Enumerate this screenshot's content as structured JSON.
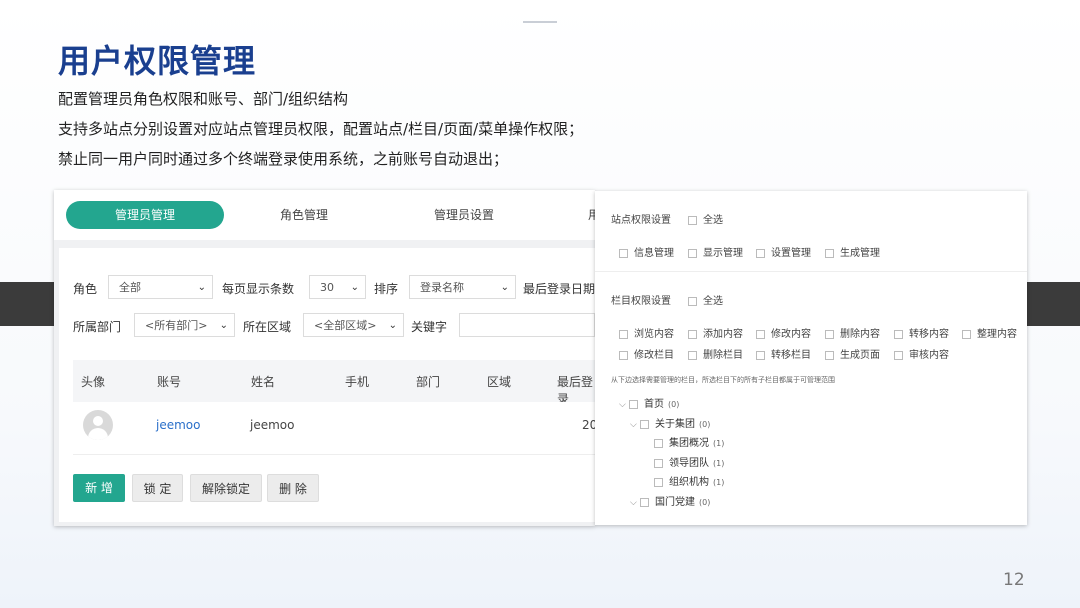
{
  "slide": {
    "title": "用户权限管理",
    "lines": [
      "配置管理员角色权限和账号、部门/组织结构",
      "支持多站点分别设置对应站点管理员权限，配置站点/栏目/页面/菜单操作权限；",
      "禁止同一用户同时通过多个终端登录使用系统，之前账号自动退出；"
    ],
    "page_number": "12",
    "accent_color": "#1a3f8f"
  },
  "admin_panel": {
    "tabs": [
      "管理员管理",
      "角色管理",
      "管理员设置",
      "用"
    ],
    "active_tab": "管理员管理",
    "accent_color": "#23a68f",
    "filters": {
      "role_label": "角色",
      "role_value": "全部",
      "pagesize_label": "每页显示条数",
      "pagesize_value": "30",
      "sort_label": "排序",
      "sort_value": "登录名称",
      "lastlogin_label": "最后登录日期",
      "dept_label": "所属部门",
      "dept_value": "<所有部门>",
      "area_label": "所在区域",
      "area_value": "<全部区域>",
      "keyword_label": "关键字"
    },
    "columns": [
      "头像",
      "账号",
      "姓名",
      "手机",
      "部门",
      "区域",
      "最后登录"
    ],
    "rows": [
      {
        "account": "jeemoo",
        "name": "jeemoo",
        "last_login": "20"
      }
    ],
    "buttons": [
      "新 增",
      "锁 定",
      "解除锁定",
      "删 除"
    ]
  },
  "permission_panel": {
    "site_label": "站点权限设置",
    "select_all": "全选",
    "site_options": [
      "信息管理",
      "显示管理",
      "设置管理",
      "生成管理"
    ],
    "column_label": "栏目权限设置",
    "column_options_row1": [
      "浏览内容",
      "添加内容",
      "修改内容",
      "删除内容",
      "转移内容",
      "整理内容"
    ],
    "column_options_row2": [
      "修改栏目",
      "删除栏目",
      "转移栏目",
      "生成页面",
      "审核内容"
    ],
    "hint": "从下边选择需要管理的栏目，所选栏目下的所有子栏目都属于可管理范围",
    "tree": [
      {
        "label": "首页",
        "count": "(0)"
      },
      {
        "label": "关于集团",
        "count": "(0)"
      },
      {
        "label": "集团概况",
        "count": "(1)"
      },
      {
        "label": "领导团队",
        "count": "(1)"
      },
      {
        "label": "组织机构",
        "count": "(1)"
      },
      {
        "label": "国门党建",
        "count": "(0)"
      }
    ]
  }
}
